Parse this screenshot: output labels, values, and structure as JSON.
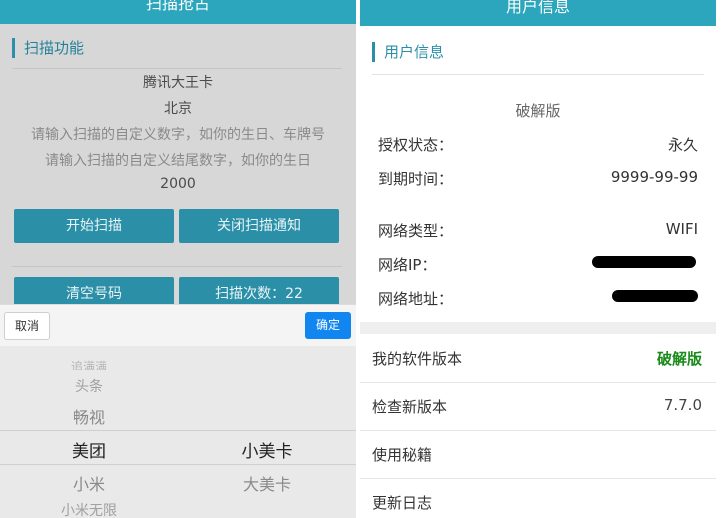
{
  "left": {
    "header_title": "扫描抢占",
    "section_title": "扫描功能",
    "card_name": "腾讯大王卡",
    "city": "北京",
    "hint1": "请输入扫描的自定义数字，如你的生日、车牌号",
    "hint2": "请输入扫描的自定义结尾数字，如你的生日",
    "year": "2000",
    "btn_start": "开始扫描",
    "btn_close_notify": "关闭扫描通知",
    "btn_clear": "清空号码",
    "btn_scan_count": "扫描次数：22",
    "picker": {
      "cancel": "取消",
      "confirm": "确定",
      "col1": [
        "追满满",
        "头条",
        "畅视",
        "美团",
        "小米",
        "小米无限"
      ],
      "col1_selected": "美团",
      "col2": [
        "小美卡",
        "大美卡"
      ],
      "col2_selected": "小美卡"
    }
  },
  "right": {
    "header_title": "用户信息",
    "section_title": "用户信息",
    "edition": "破解版",
    "rows": [
      {
        "label": "授权状态：",
        "value": "永久"
      },
      {
        "label": "到期时间：",
        "value": "9999-99-99"
      },
      {
        "label": "网络类型：",
        "value": "WIFI"
      },
      {
        "label": "网络IP：",
        "value": ""
      },
      {
        "label": "网络地址：",
        "value": ""
      }
    ],
    "list": [
      {
        "label": "我的软件版本",
        "value": "破解版"
      },
      {
        "label": "检查新版本",
        "value": "7.7.0"
      },
      {
        "label": "使用秘籍",
        "value": ""
      },
      {
        "label": "更新日志",
        "value": ""
      }
    ]
  },
  "colors": {
    "header": "#2ba6bd",
    "button": "#2b8fa8",
    "confirm": "#1185f0",
    "cracked_text": "#1a8a1a"
  }
}
